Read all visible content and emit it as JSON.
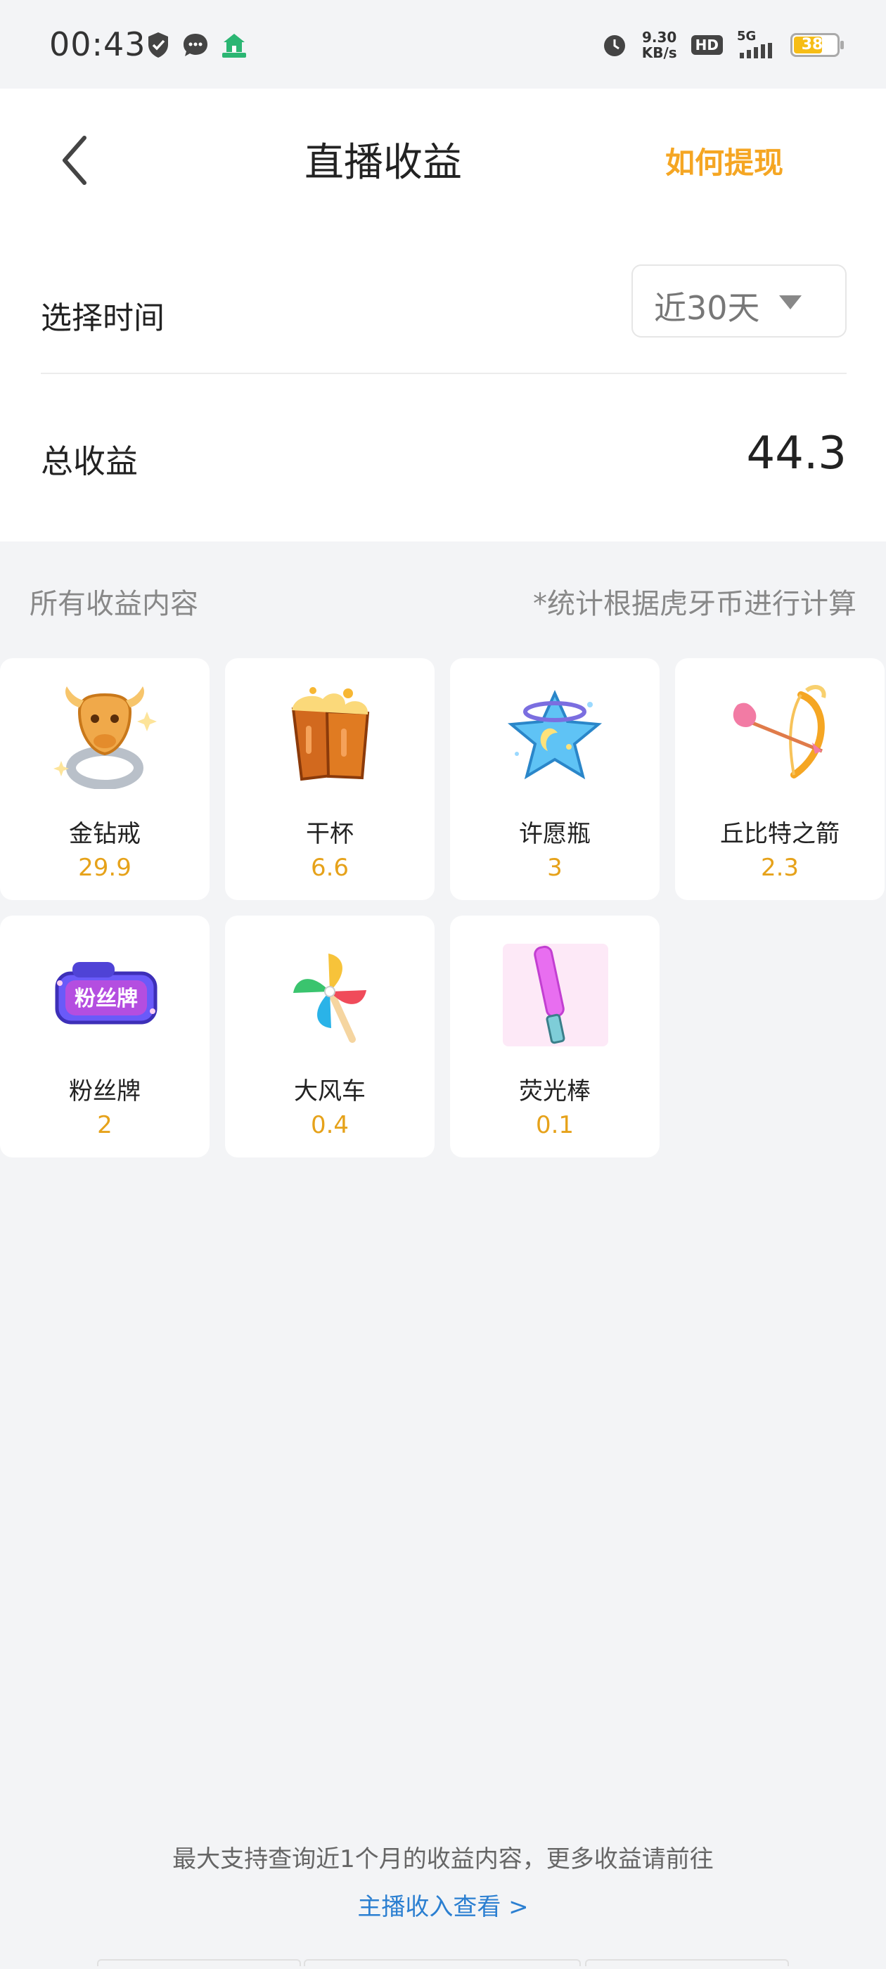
{
  "status_bar": {
    "time": "00:43",
    "net_speed_value": "9.30",
    "net_speed_unit": "KB/s",
    "hd": "HD",
    "signal": "5G",
    "battery": "38"
  },
  "nav": {
    "title": "直播收益",
    "withdraw_label": "如何提现"
  },
  "filter": {
    "label": "选择时间",
    "selected": "近30天"
  },
  "total": {
    "label": "总收益",
    "value": "44.3"
  },
  "section": {
    "title": "所有收益内容",
    "note": "*统计根据虎牙币进行计算"
  },
  "gifts": [
    {
      "name": "金钻戒",
      "value": "29.9",
      "icon": "gold-ring-icon"
    },
    {
      "name": "干杯",
      "value": "6.6",
      "icon": "cheers-icon"
    },
    {
      "name": "许愿瓶",
      "value": "3",
      "icon": "wish-bottle-icon"
    },
    {
      "name": "丘比特之箭",
      "value": "2.3",
      "icon": "cupid-arrow-icon"
    },
    {
      "name": "粉丝牌",
      "value": "2",
      "icon": "fan-badge-icon"
    },
    {
      "name": "大风车",
      "value": "0.4",
      "icon": "pinwheel-icon"
    },
    {
      "name": "荧光棒",
      "value": "0.1",
      "icon": "glow-stick-icon"
    }
  ],
  "footer": {
    "note": "最大支持查询近1个月的收益内容，更多收益请前往",
    "link": "主播收入查看 >"
  },
  "colors": {
    "accent": "#f5a623",
    "value": "#e6a21a",
    "link": "#2b7fd1",
    "background": "#f3f4f6"
  }
}
